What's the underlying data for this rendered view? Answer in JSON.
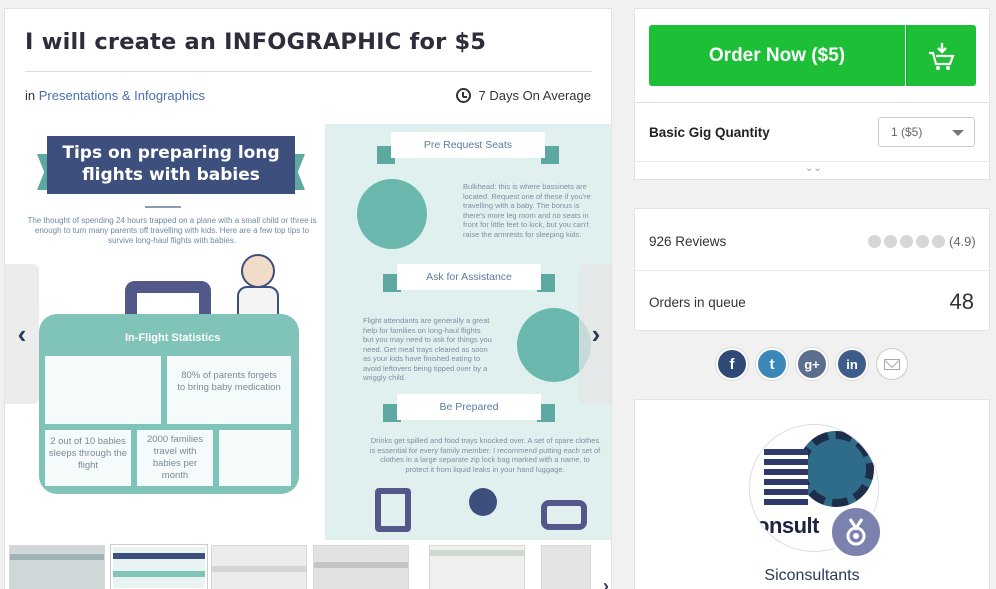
{
  "gig": {
    "title": "I will create an INFOGRAPHIC for $5",
    "category_prefix": "in",
    "category": "Presentations & Infographics",
    "delivery": "7 Days On Average"
  },
  "gallery": {
    "infographic": {
      "heading_line1": "Tips on preparing long",
      "heading_line2": "flights with babies",
      "intro": "The thought of spending 24 hours trapped on a plane with a small child or three is enough to turn many parents off travelling with kids. Here are a few top tips to survive long-haul flights with babies.",
      "stats_title": "In-Flight Statistics",
      "stat_1": "80% of parents forgets to bring baby medication",
      "stat_2": "2 out of 10 babies sleeps through the flight",
      "stat_3": "2000 families travel with babies per month",
      "section_1": "Pre Request Seats",
      "section_1_text": "Bulkhead: this is where bassinets are located. Request one of these if you're travelling with a baby. The bonus is there's more leg room and no seats in front for little feet to kick, but you can't raise the armrests for sleeping kids.",
      "section_2": "Ask for Assistance",
      "section_2_text": "Flight attendants are generally a great help for families on long-haul flights but you may need to ask for things you need. Get meal trays cleared as soon as your kids have finished eating to avoid leftovers being tipped over by a wriggly child.",
      "section_3": "Be Prepared",
      "section_3_text": "Drinks get spilled and food trays knocked over. A set of spare clothes is essential for every family member. I recommend putting each set of clothes in a large separate zip lock bag marked with a name, to protect it from liquid leaks in your hand luggage."
    },
    "thumbnails_count": 6
  },
  "order": {
    "button_label": "Order Now ($5)",
    "quantity_label": "Basic Gig Quantity",
    "quantity_value": "1 ($5)",
    "expand_glyph": "⌄⌄"
  },
  "stats": {
    "reviews_label": "926 Reviews",
    "rating": "(4.9)",
    "star_count": 5,
    "queue_label": "Orders in queue",
    "queue_value": "48"
  },
  "social": {
    "facebook": "f",
    "twitter": "t",
    "google": "g+",
    "linkedin": "in"
  },
  "seller": {
    "name": "Siconsultants",
    "avatar_text": "onsult"
  },
  "colors": {
    "order_green": "#1dbf37",
    "link_blue": "#4a6eb4",
    "navy": "#3d4f7c",
    "teal": "#7fc3b9"
  }
}
